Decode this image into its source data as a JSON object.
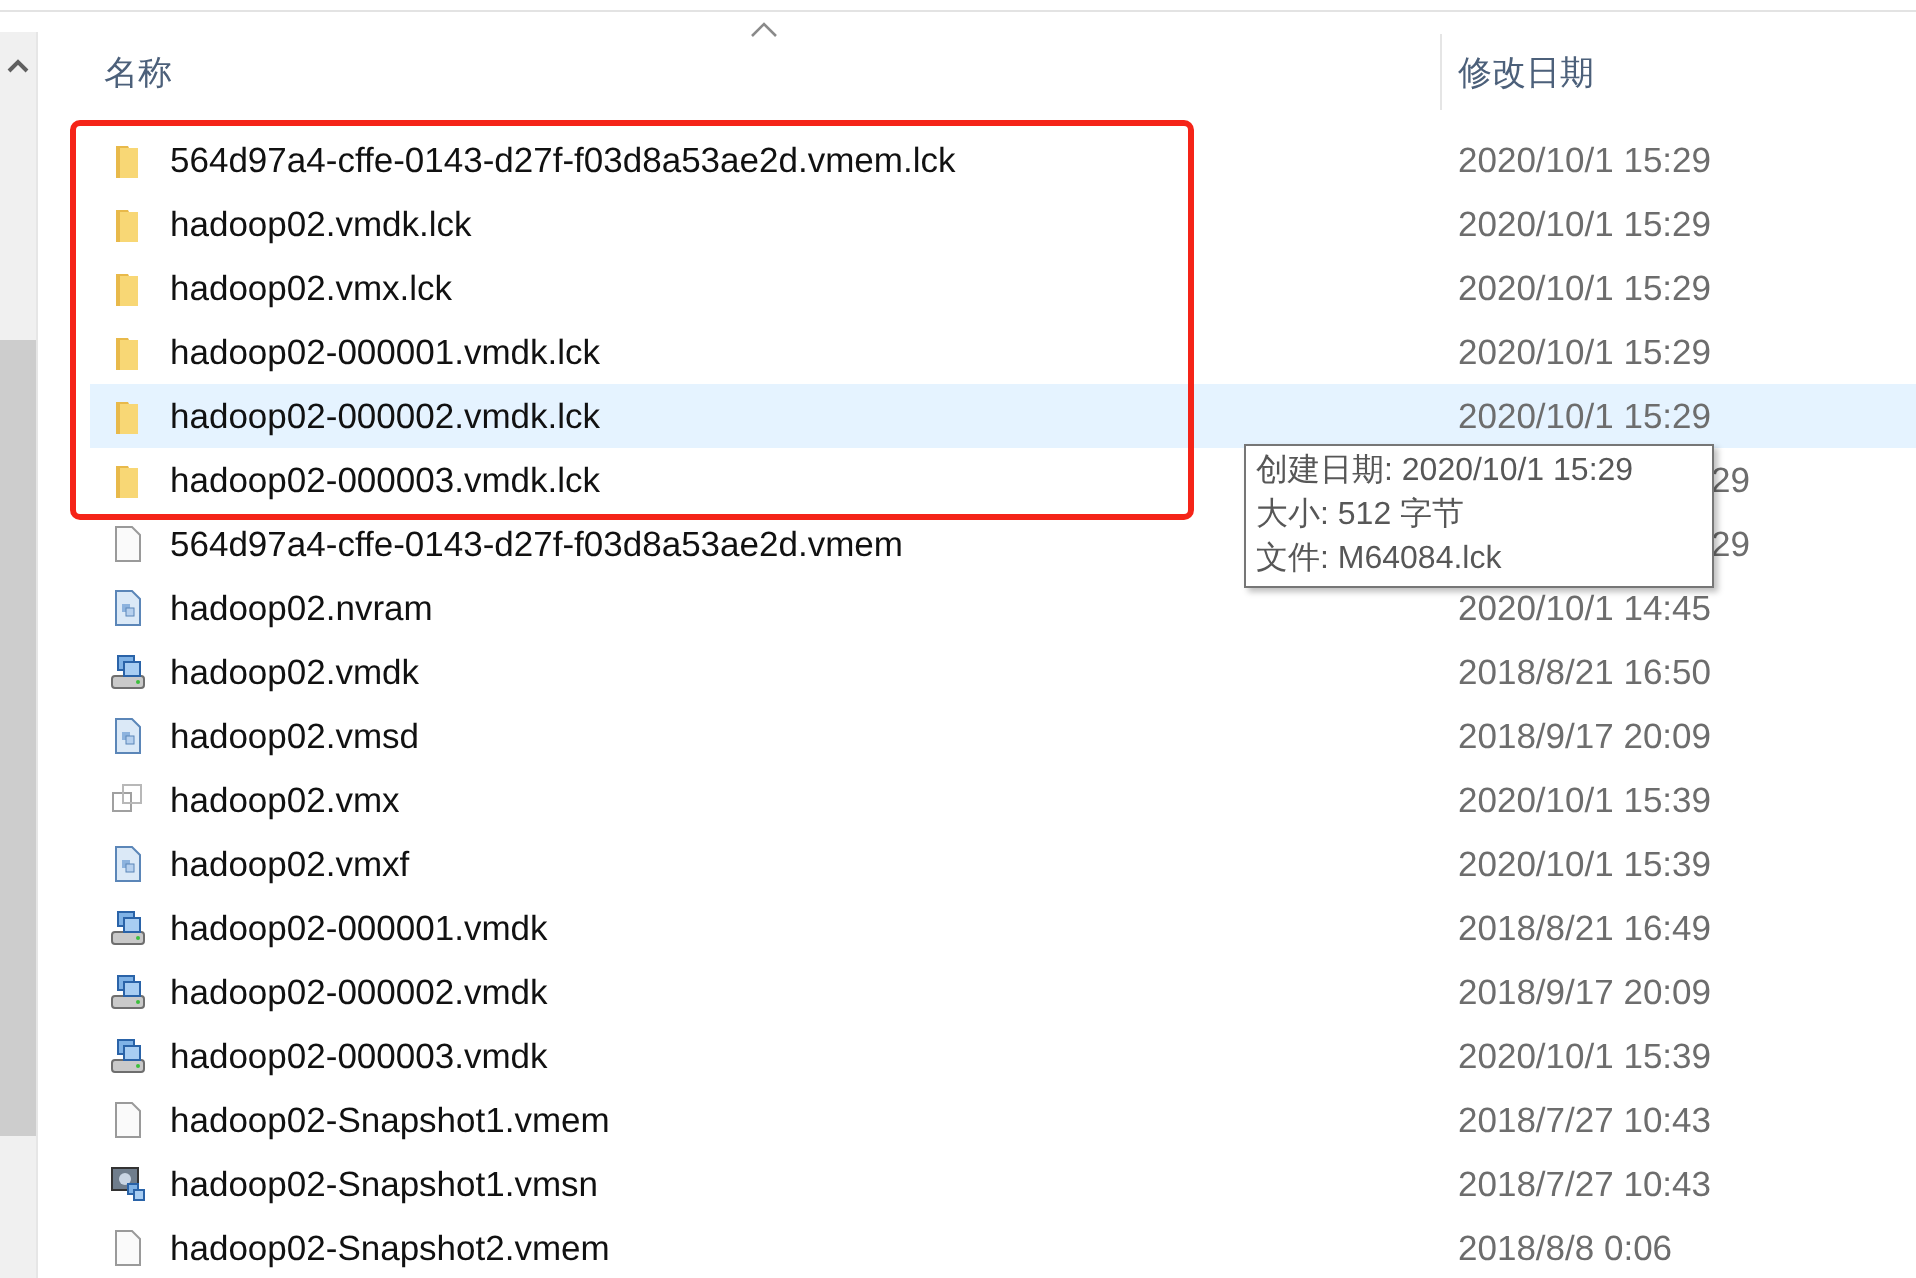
{
  "columns": [
    "名称",
    "修改日期"
  ],
  "highlighted_files": [
    {
      "name": "564d97a4-cffe-0143-d27f-f03d8a53ae2d.vmem.lck",
      "date": "2020/10/1 15:29",
      "kind": "folder",
      "selected": false
    },
    {
      "name": "hadoop02.vmdk.lck",
      "date": "2020/10/1 15:29",
      "kind": "folder",
      "selected": false
    },
    {
      "name": "hadoop02.vmx.lck",
      "date": "2020/10/1 15:29",
      "kind": "folder",
      "selected": false
    },
    {
      "name": "hadoop02-000001.vmdk.lck",
      "date": "2020/10/1 15:29",
      "kind": "folder",
      "selected": false
    },
    {
      "name": "hadoop02-000002.vmdk.lck",
      "date": "2020/10/1 15:29",
      "kind": "folder",
      "selected": true
    },
    {
      "name": "hadoop02-000003.vmdk.lck",
      "date_tail": "29",
      "kind": "folder",
      "selected": false
    }
  ],
  "files": [
    {
      "name": "564d97a4-cffe-0143-d27f-f03d8a53ae2d.vmem",
      "date_tail": "29",
      "kind": "blank",
      "selected": false
    },
    {
      "name": "hadoop02.nvram",
      "date": "2020/10/1 14:45",
      "kind": "vmdoc",
      "selected": false
    },
    {
      "name": "hadoop02.vmdk",
      "date": "2018/8/21 16:50",
      "kind": "disk",
      "selected": false
    },
    {
      "name": "hadoop02.vmsd",
      "date": "2018/9/17 20:09",
      "kind": "vmdoc",
      "selected": false
    },
    {
      "name": "hadoop02.vmx",
      "date": "2020/10/1 15:39",
      "kind": "vmx",
      "selected": false
    },
    {
      "name": "hadoop02.vmxf",
      "date": "2020/10/1 15:39",
      "kind": "vmdoc",
      "selected": false
    },
    {
      "name": "hadoop02-000001.vmdk",
      "date": "2018/8/21 16:49",
      "kind": "disk",
      "selected": false
    },
    {
      "name": "hadoop02-000002.vmdk",
      "date": "2018/9/17 20:09",
      "kind": "disk",
      "selected": false
    },
    {
      "name": "hadoop02-000003.vmdk",
      "date": "2020/10/1 15:39",
      "kind": "disk",
      "selected": false
    },
    {
      "name": "hadoop02-Snapshot1.vmem",
      "date": "2018/7/27 10:43",
      "kind": "blank",
      "selected": false
    },
    {
      "name": "hadoop02-Snapshot1.vmsn",
      "date": "2018/7/27 10:43",
      "kind": "snapshot",
      "selected": false
    },
    {
      "name": "hadoop02-Snapshot2.vmem",
      "date": "2018/8/8 0:06",
      "kind": "blank",
      "selected": false
    }
  ],
  "tooltip": [
    "创建日期: 2020/10/1 15:29",
    "大小: 512 字节",
    "文件: M64084.lck"
  ]
}
